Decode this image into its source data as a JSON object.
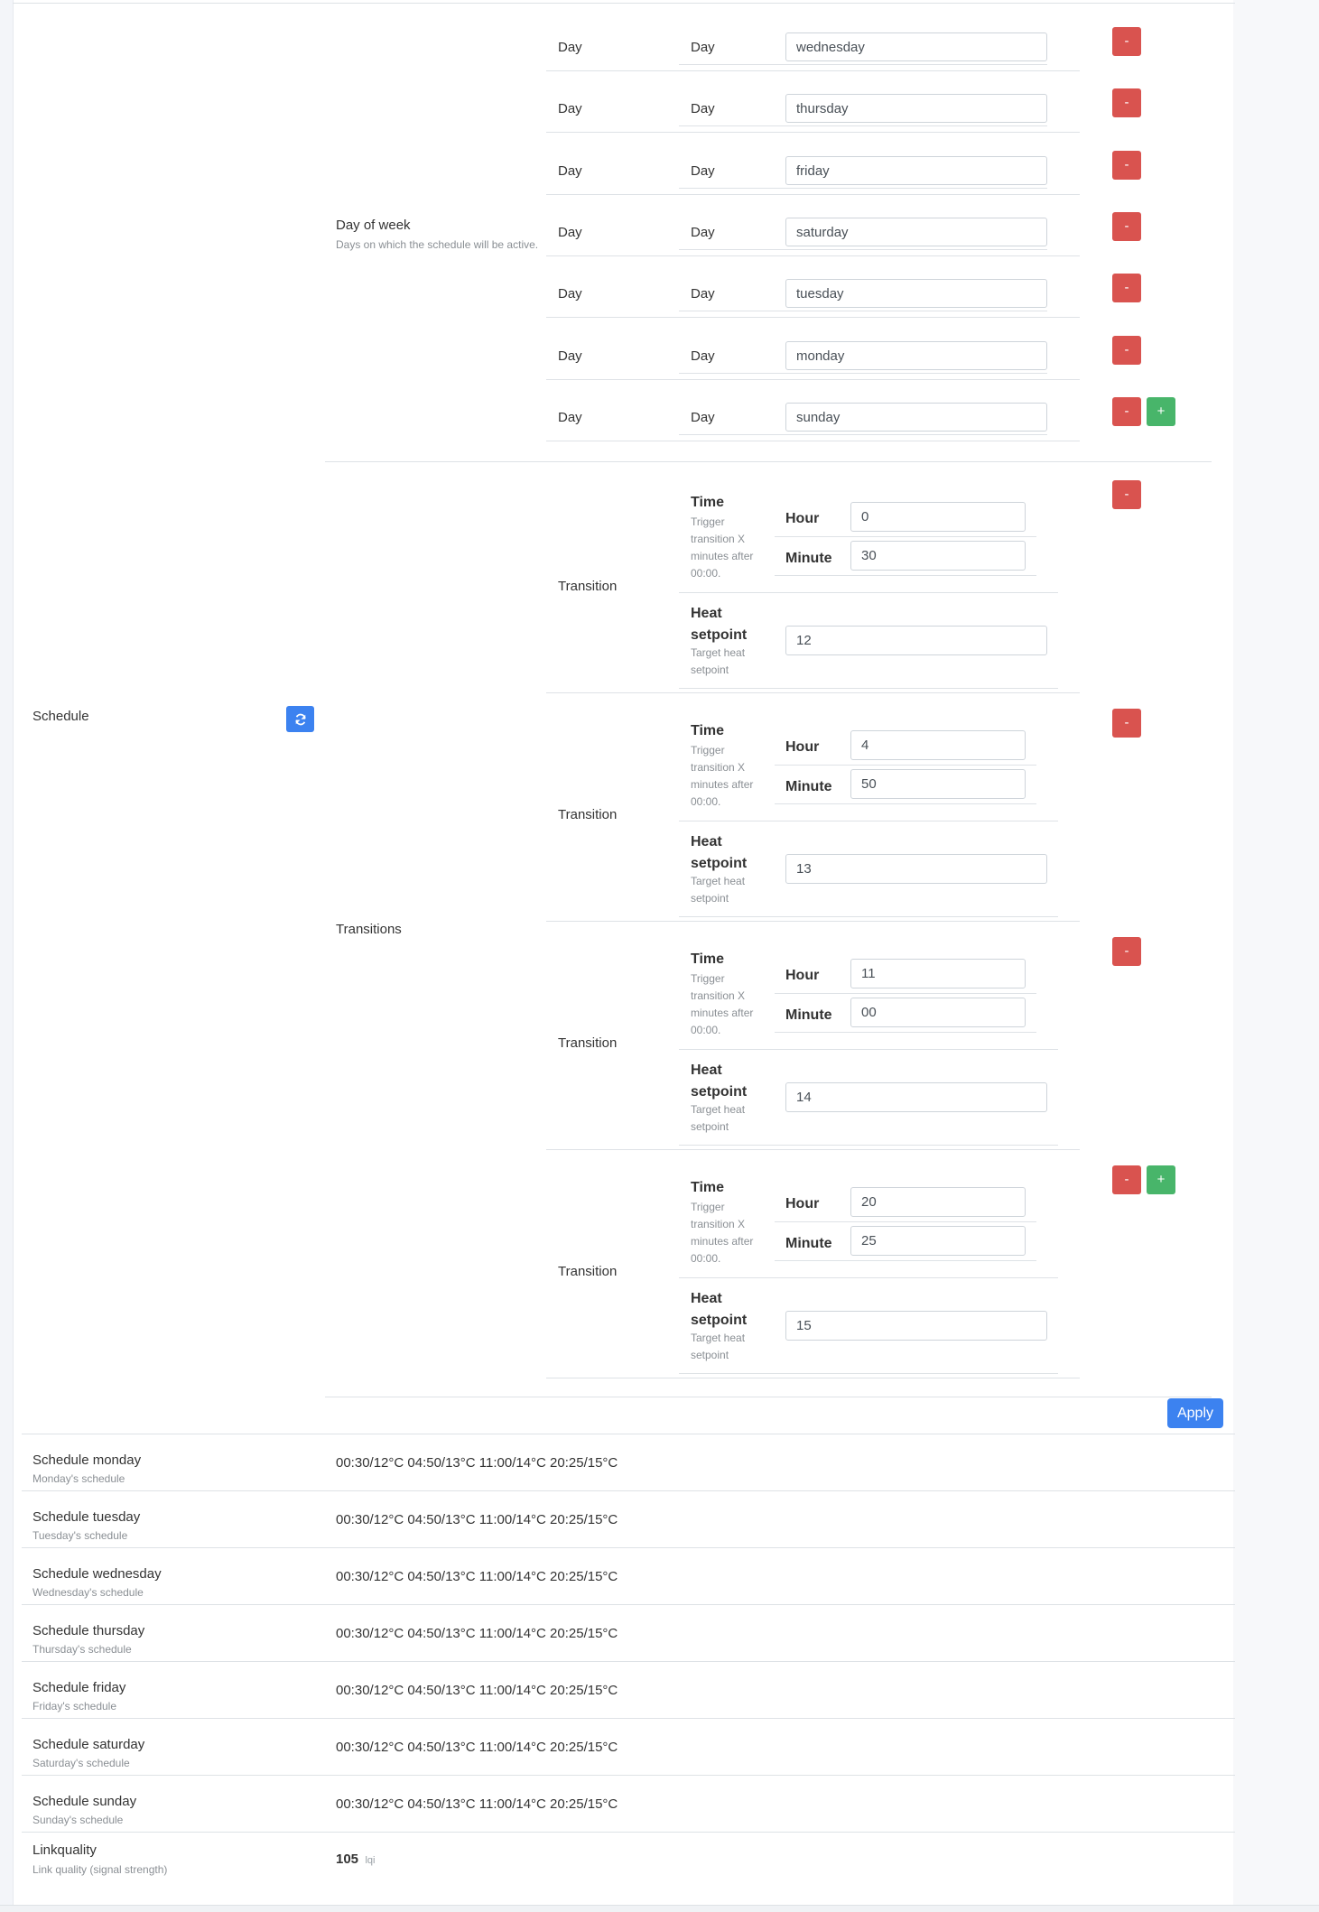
{
  "schedule": {
    "label": "Schedule",
    "refresh_icon": "refresh-icon",
    "day_of_week": {
      "label": "Day of week",
      "description": "Days on which the schedule will be active.",
      "rows": [
        {
          "outer_label": "Day",
          "inner_label": "Day",
          "value": "wednesday"
        },
        {
          "outer_label": "Day",
          "inner_label": "Day",
          "value": "thursday"
        },
        {
          "outer_label": "Day",
          "inner_label": "Day",
          "value": "friday"
        },
        {
          "outer_label": "Day",
          "inner_label": "Day",
          "value": "saturday"
        },
        {
          "outer_label": "Day",
          "inner_label": "Day",
          "value": "tuesday"
        },
        {
          "outer_label": "Day",
          "inner_label": "Day",
          "value": "monday"
        },
        {
          "outer_label": "Day",
          "inner_label": "Day",
          "value": "sunday"
        }
      ]
    },
    "transitions": {
      "label": "Transitions",
      "items": [
        {
          "label": "Transition",
          "time_label": "Time",
          "time_description": "Trigger transition X minutes after 00:00.",
          "hour_label": "Hour",
          "hour": "0",
          "minute_label": "Minute",
          "minute": "30",
          "heat_label": "Heat setpoint",
          "heat_description": "Target heat setpoint",
          "heat": "12"
        },
        {
          "label": "Transition",
          "time_label": "Time",
          "time_description": "Trigger transition X minutes after 00:00.",
          "hour_label": "Hour",
          "hour": "4",
          "minute_label": "Minute",
          "minute": "50",
          "heat_label": "Heat setpoint",
          "heat_description": "Target heat setpoint",
          "heat": "13"
        },
        {
          "label": "Transition",
          "time_label": "Time",
          "time_description": "Trigger transition X minutes after 00:00.",
          "hour_label": "Hour",
          "hour": "11",
          "minute_label": "Minute",
          "minute": "00",
          "heat_label": "Heat setpoint",
          "heat_description": "Target heat setpoint",
          "heat": "14"
        },
        {
          "label": "Transition",
          "time_label": "Time",
          "time_description": "Trigger transition X minutes after 00:00.",
          "hour_label": "Hour",
          "hour": "20",
          "minute_label": "Minute",
          "minute": "25",
          "heat_label": "Heat setpoint",
          "heat_description": "Target heat setpoint",
          "heat": "15"
        }
      ]
    },
    "remove_label": "-",
    "add_label": "+",
    "apply_label": "Apply"
  },
  "schedule_rows": [
    {
      "name": "Schedule monday",
      "description": "Monday's schedule",
      "value": "00:30/12°C 04:50/13°C 11:00/14°C 20:25/15°C"
    },
    {
      "name": "Schedule tuesday",
      "description": "Tuesday's schedule",
      "value": "00:30/12°C 04:50/13°C 11:00/14°C 20:25/15°C"
    },
    {
      "name": "Schedule wednesday",
      "description": "Wednesday's schedule",
      "value": "00:30/12°C 04:50/13°C 11:00/14°C 20:25/15°C"
    },
    {
      "name": "Schedule thursday",
      "description": "Thursday's schedule",
      "value": "00:30/12°C 04:50/13°C 11:00/14°C 20:25/15°C"
    },
    {
      "name": "Schedule friday",
      "description": "Friday's schedule",
      "value": "00:30/12°C 04:50/13°C 11:00/14°C 20:25/15°C"
    },
    {
      "name": "Schedule saturday",
      "description": "Saturday's schedule",
      "value": "00:30/12°C 04:50/13°C 11:00/14°C 20:25/15°C"
    },
    {
      "name": "Schedule sunday",
      "description": "Sunday's schedule",
      "value": "00:30/12°C 04:50/13°C 11:00/14°C 20:25/15°C"
    }
  ],
  "linkquality": {
    "name": "Linkquality",
    "description": "Link quality (signal strength)",
    "value": "105",
    "unit": "lqi"
  },
  "colors": {
    "danger": "#d9534f",
    "success": "#48b56a",
    "primary": "#3c82f0"
  }
}
